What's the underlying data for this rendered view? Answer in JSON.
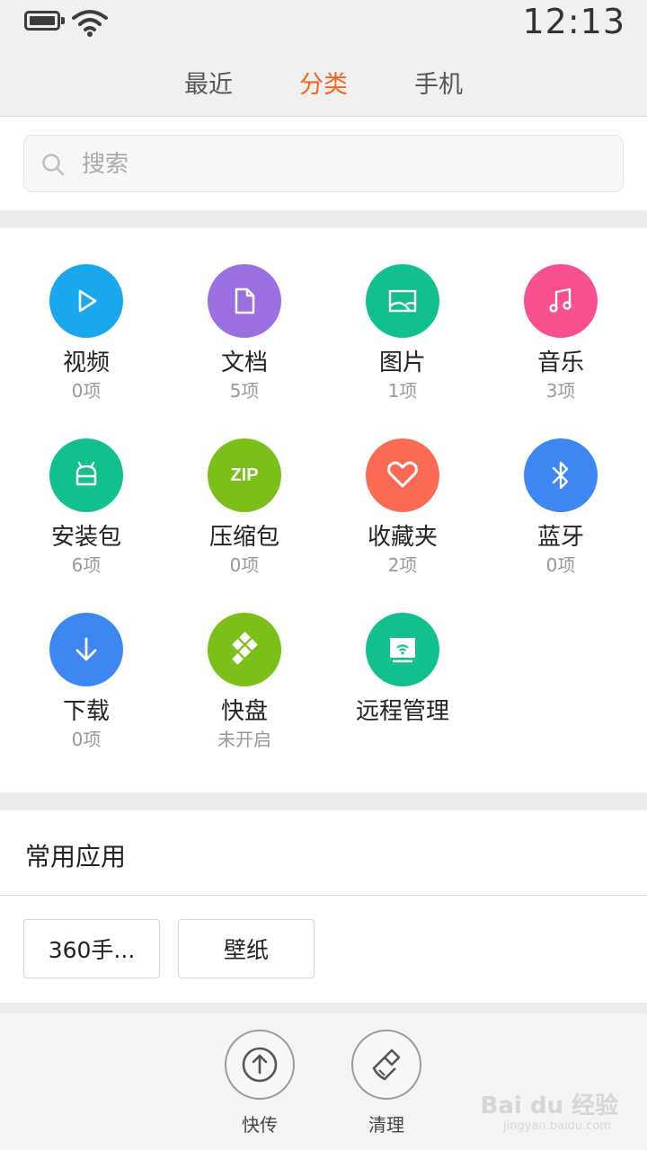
{
  "status": {
    "time": "12:13"
  },
  "tabs": [
    {
      "label": "最近",
      "active": false
    },
    {
      "label": "分类",
      "active": true
    },
    {
      "label": "手机",
      "active": false
    }
  ],
  "search": {
    "placeholder": "搜索"
  },
  "categories": [
    {
      "name": "视频",
      "count": "0项",
      "icon": "play-icon",
      "color": "#1aa7ec"
    },
    {
      "name": "文档",
      "count": "5项",
      "icon": "document-icon",
      "color": "#9b6fe0"
    },
    {
      "name": "图片",
      "count": "1项",
      "icon": "image-icon",
      "color": "#14bf8e"
    },
    {
      "name": "音乐",
      "count": "3项",
      "icon": "music-icon",
      "color": "#f7508f"
    },
    {
      "name": "安装包",
      "count": "6项",
      "icon": "android-icon",
      "color": "#14bf8e"
    },
    {
      "name": "压缩包",
      "count": "0项",
      "icon": "zip-icon",
      "color": "#7cbf1a",
      "icon_text": "ZIP"
    },
    {
      "name": "收藏夹",
      "count": "2项",
      "icon": "heart-icon",
      "color": "#fb6a55"
    },
    {
      "name": "蓝牙",
      "count": "0项",
      "icon": "bluetooth-icon",
      "color": "#3e86f1"
    },
    {
      "name": "下载",
      "count": "0项",
      "icon": "download-icon",
      "color": "#3e86f1"
    },
    {
      "name": "快盘",
      "count": "未开启",
      "icon": "kuaipan-icon",
      "color": "#7cbf1a"
    },
    {
      "name": "远程管理",
      "count": "",
      "icon": "remote-icon",
      "color": "#14bf8e"
    }
  ],
  "common_apps": {
    "title": "常用应用",
    "items": [
      "360手...",
      "壁纸"
    ]
  },
  "bottom": [
    {
      "label": "快传",
      "icon": "upload-icon"
    },
    {
      "label": "清理",
      "icon": "broom-icon"
    }
  ],
  "watermark": {
    "text": "Bai du 经验",
    "sub": "jingyan.baidu.com"
  }
}
